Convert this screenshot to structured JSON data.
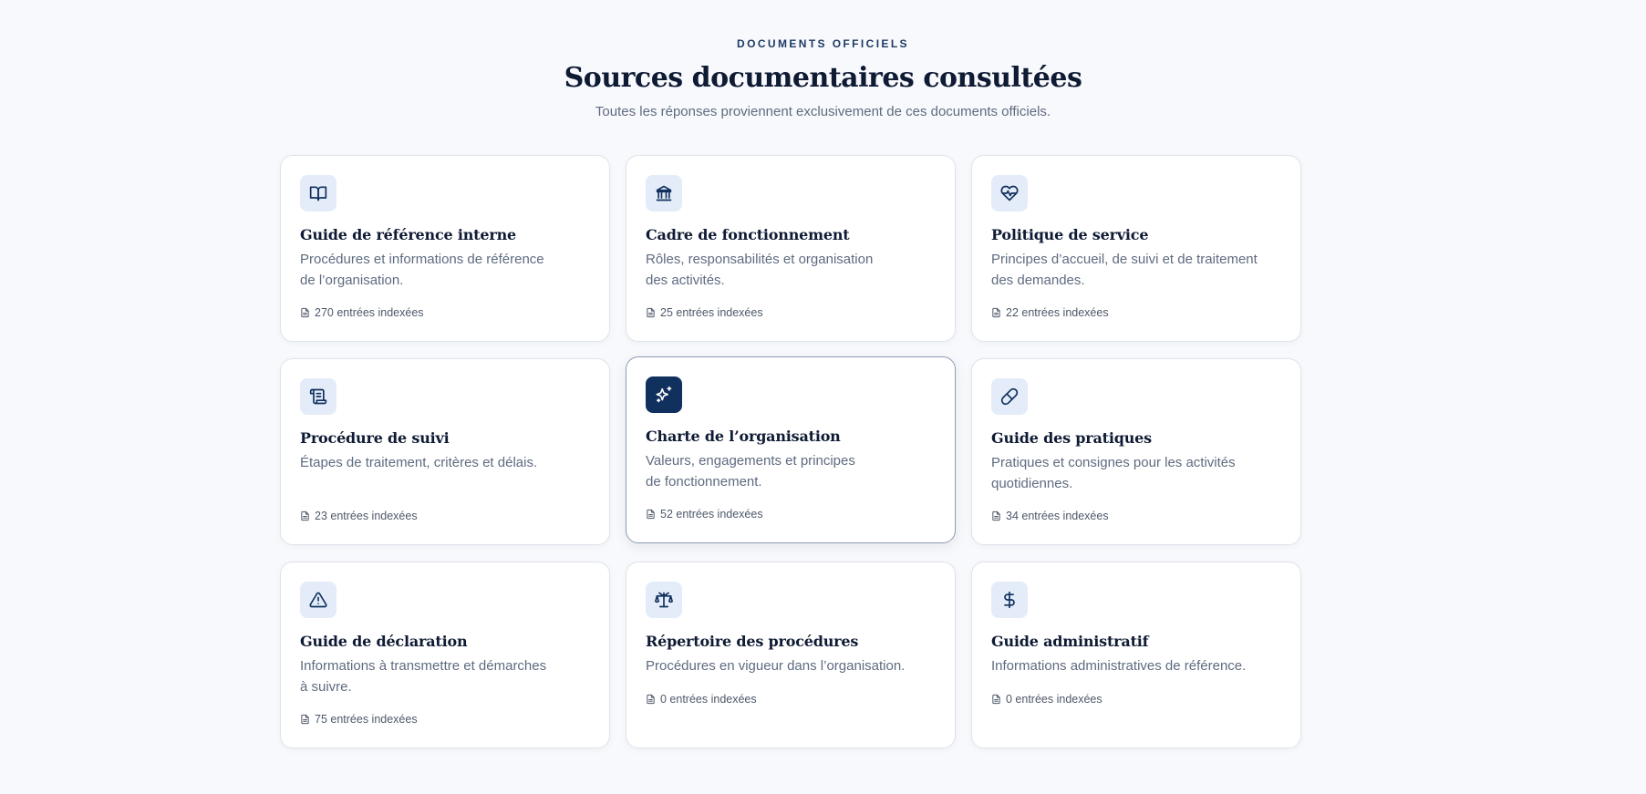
{
  "header": {
    "eyebrow": "DOCUMENTS OFFICIELS",
    "title": "Sources documentaires consultées",
    "subtitle": "Toutes les réponses proviennent exclusivement de ces documents officiels."
  },
  "colors": {
    "accent": "#10305e",
    "icon_bg": "#e3ecf8",
    "title": "#0f1b34",
    "muted": "#5f6b80"
  },
  "cards": [
    {
      "icon": "book-open-icon",
      "title": "Guide de référence interne",
      "desc_line1": "Procédures et informations de référence",
      "desc_line2": "de l’organisation.",
      "entries": "270 entrées indexées"
    },
    {
      "icon": "bank-icon",
      "title": "Cadre de fonctionnement",
      "desc_line1": "Rôles, responsabilités et organisation",
      "desc_line2": "des activités.",
      "entries": "25 entrées indexées"
    },
    {
      "icon": "heart-pulse-icon",
      "title": "Politique de service",
      "desc_line1": "Principes d’accueil, de suivi et de traitement",
      "desc_line2": "des demandes.",
      "entries": "22 entrées indexées"
    },
    {
      "icon": "scroll-icon",
      "title": "Procédure de suivi",
      "desc_line1": "Étapes de traitement, critères et délais.",
      "desc_line2": "",
      "entries": "23 entrées indexées"
    },
    {
      "icon": "sparkles-icon",
      "title": "Charte de l’organisation",
      "desc_line1": "Valeurs, engagements et principes",
      "desc_line2": "de fonctionnement.",
      "entries": "52 entrées indexées",
      "active": true
    },
    {
      "icon": "pill-icon",
      "title": "Guide des pratiques",
      "desc_line1": "Pratiques et consignes pour les activités",
      "desc_line2": "quotidiennes.",
      "entries": "34 entrées indexées"
    },
    {
      "icon": "warning-triangle-icon",
      "title": "Guide de déclaration",
      "desc_line1": "Informations à transmettre et démarches",
      "desc_line2": "à suivre.",
      "entries": "75 entrées indexées"
    },
    {
      "icon": "scale-icon",
      "title": "Répertoire des procédures",
      "desc_line1": "Procédures en vigueur dans l’organisation.",
      "desc_line2": "",
      "entries": "0 entrées indexées"
    },
    {
      "icon": "dollar-icon",
      "title": "Guide administratif",
      "desc_line1": "Informations administratives de référence.",
      "desc_line2": "",
      "entries": "0 entrées indexées"
    }
  ]
}
